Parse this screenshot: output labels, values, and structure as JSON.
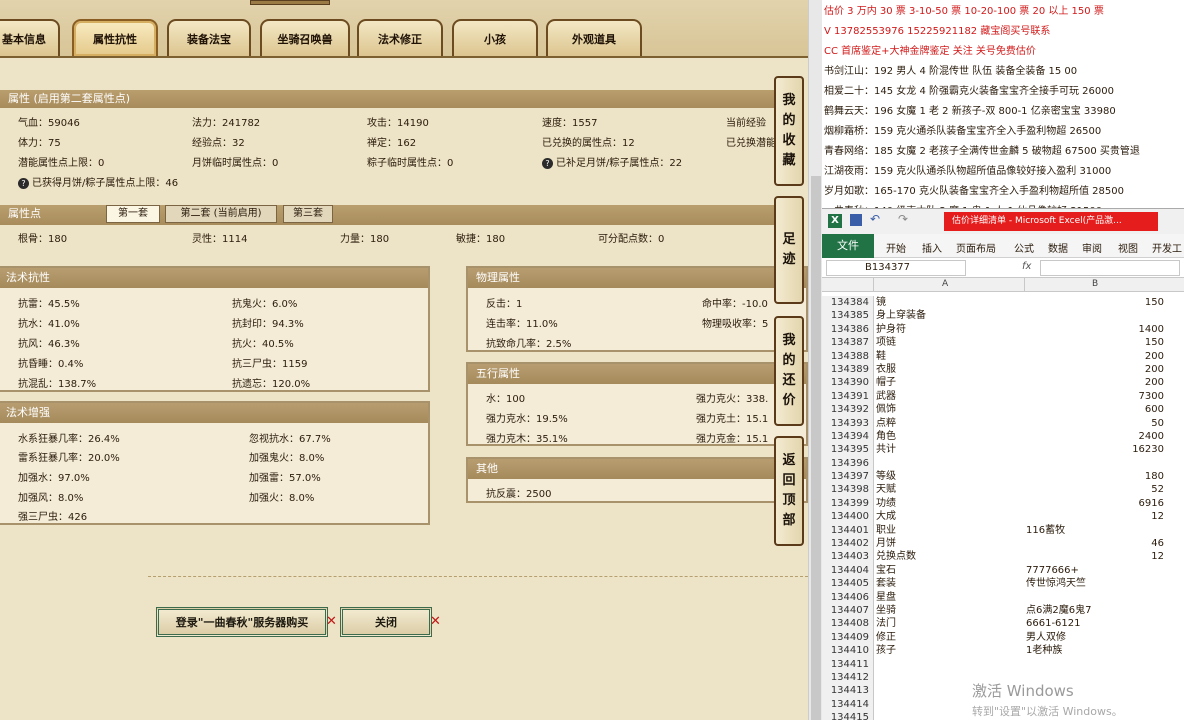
{
  "game": {
    "tabs": [
      "基本信息",
      "属性抗性",
      "装备法宝",
      "坐骑召唤兽",
      "法术修正",
      "小孩",
      "外观道具"
    ],
    "attr_header": "属性 (启用第二套属性点)",
    "attr_rows": [
      [
        "气血：59046",
        "法力：241782",
        "攻击：14190",
        "速度：1557",
        "当前经验"
      ],
      [
        "体力：75",
        "经验点：32",
        "禅定：162",
        "已兑换的属性点：12",
        "已兑换潜能"
      ],
      [
        "潜能属性点上限：0",
        "月饼临时属性点：0",
        "粽子临时属性点：0",
        "已补足月饼/粽子属性点：22",
        ""
      ]
    ],
    "moon_limit": "已获得月饼/粽子属性点上限：46",
    "points_header": "属性点",
    "subtabs": [
      "第一套",
      "第二套 (当前启用)",
      "第三套"
    ],
    "points_row": [
      "根骨：180",
      "灵性：1114",
      "力量：180",
      "敏捷：180",
      "可分配点数：0"
    ],
    "magic_res": {
      "title": "法术抗性",
      "items": [
        "抗雷：45.5%",
        "抗鬼火：6.0%",
        "抗水：41.0%",
        "抗封印：94.3%",
        "抗风：46.3%",
        "抗火：40.5%",
        "抗昏睡：0.4%",
        "抗三尸虫：1159",
        "抗混乱：138.7%",
        "抗遗忘：120.0%"
      ]
    },
    "magic_boost": {
      "title": "法术增强",
      "items": [
        "水系狂暴几率：26.4%",
        "忽视抗水：67.7%",
        "雷系狂暴几率：20.0%",
        "加强鬼火：8.0%",
        "加强水：97.0%",
        "加强雷：57.0%",
        "加强风：8.0%",
        "加强火：8.0%",
        "强三尸虫：426",
        ""
      ]
    },
    "phys": {
      "title": "物理属性",
      "items": [
        "反击：1",
        "命中率：-10.0",
        "连击率：11.0%",
        "物理吸收率：5",
        "抗致命几率：2.5%",
        ""
      ]
    },
    "five": {
      "title": "五行属性",
      "items": [
        "水：100",
        "强力克火：338.",
        "强力克水：19.5%",
        "强力克土：15.1",
        "强力克木：35.1%",
        "强力克金：15.1"
      ]
    },
    "other": {
      "title": "其他",
      "items": [
        "抗反震：2500"
      ]
    },
    "buttons": {
      "buy": "登录\"一曲春秋\"服务器购买",
      "close": "关闭"
    },
    "side": [
      [
        "我",
        "的",
        "收",
        "藏"
      ],
      [
        "足",
        "迹"
      ],
      [
        "我",
        "的",
        "还",
        "价"
      ],
      [
        "返",
        "回",
        "顶",
        "部"
      ]
    ]
  },
  "notes": [
    {
      "text": "估价 3 万内 30 票    3-10-50 票    10-20-100 票    20 以上 150 票",
      "red": true
    },
    {
      "text": "V 13782553976    15225921182   藏宝阁买号联系",
      "red": true
    },
    {
      "text": "CC 首席鉴定+大神金牌鉴定 关注  关号免费估价",
      "red": true
    },
    {
      "text": "书剑江山：192 男人 4 阶混传世 队伍 装备全装备 15 00",
      "red": false
    },
    {
      "text": "相爱二十：145 女龙 4 阶强霸克火装备宝宝齐全接手可玩 26000",
      "red": false
    },
    {
      "text": "鹤舞云天：196 女魔 1 老 2 新孩子-双 800-1 亿亲密宝宝 33980",
      "red": false
    },
    {
      "text": "烟柳霜桥：159 克火通杀队装备宝宝齐全入手盈利物超 26500",
      "red": false
    },
    {
      "text": "青春网络：185 女魔 2 老孩子全满传世金麟 5 破物超 67500 买贵管退",
      "red": false
    },
    {
      "text": "江湖夜雨：159 克火队通杀队物超所值品像较好接入盈利 31000",
      "red": false
    },
    {
      "text": "岁月如歌：165-170 克火队装备宝宝齐全入手盈利物超所值 28500",
      "red": false
    },
    {
      "text": "一曲春秋：140 级克木队 2 魔 1 鬼 1 人 1 仙品像较好 21500",
      "red": false
    }
  ],
  "excel": {
    "title": "估价详细清单 - Microsoft Excel(产品激...",
    "ribbon": [
      "文件",
      "开始",
      "插入",
      "页面布局",
      "公式",
      "数据",
      "审阅",
      "视图",
      "开发工"
    ],
    "namebox": "B134377",
    "fx": "fx",
    "col_a": "A",
    "col_b": "B",
    "rows": [
      [
        "134384",
        "镜",
        "150"
      ],
      [
        "134385",
        "身上穿装备",
        ""
      ],
      [
        "134386",
        "护身符",
        "1400"
      ],
      [
        "134387",
        "项链",
        "150"
      ],
      [
        "134388",
        "鞋",
        "200"
      ],
      [
        "134389",
        "衣服",
        "200"
      ],
      [
        "134390",
        "帽子",
        "200"
      ],
      [
        "134391",
        "武器",
        "7300"
      ],
      [
        "134392",
        "佩饰",
        "600"
      ],
      [
        "134393",
        "点粹",
        "50"
      ],
      [
        "134394",
        "角色",
        "2400"
      ],
      [
        "134395",
        "共计",
        "16230"
      ],
      [
        "134396",
        "",
        ""
      ],
      [
        "134397",
        "等级",
        "180"
      ],
      [
        "134398",
        "天赋",
        "52"
      ],
      [
        "134399",
        "功绩",
        "6916"
      ],
      [
        "134400",
        "大成",
        "12"
      ],
      [
        "134401",
        "职业",
        "116蓄牧"
      ],
      [
        "134402",
        "月饼",
        "46"
      ],
      [
        "134403",
        "兑换点数",
        "12"
      ],
      [
        "134404",
        "宝石",
        "7777666+"
      ],
      [
        "134405",
        "套装",
        "传世惊鸿天竺"
      ],
      [
        "134406",
        "星盘",
        ""
      ],
      [
        "134407",
        "坐骑",
        "点6满2魔6鬼7"
      ],
      [
        "134408",
        "法门",
        "6661-6121"
      ],
      [
        "134409",
        "修正",
        "男人双修"
      ],
      [
        "134410",
        "孩子",
        "1老种族"
      ],
      [
        "134411",
        "",
        ""
      ],
      [
        "134412",
        "",
        ""
      ],
      [
        "134413",
        "",
        ""
      ],
      [
        "134414",
        "",
        ""
      ],
      [
        "134415",
        "",
        ""
      ]
    ],
    "watermark": "激活 Windows",
    "watermark2": "转到\"设置\"以激活 Windows。"
  },
  "colors": {
    "red": "#d21919",
    "excel_green": "#217346",
    "parchment": "#efe6cd"
  }
}
